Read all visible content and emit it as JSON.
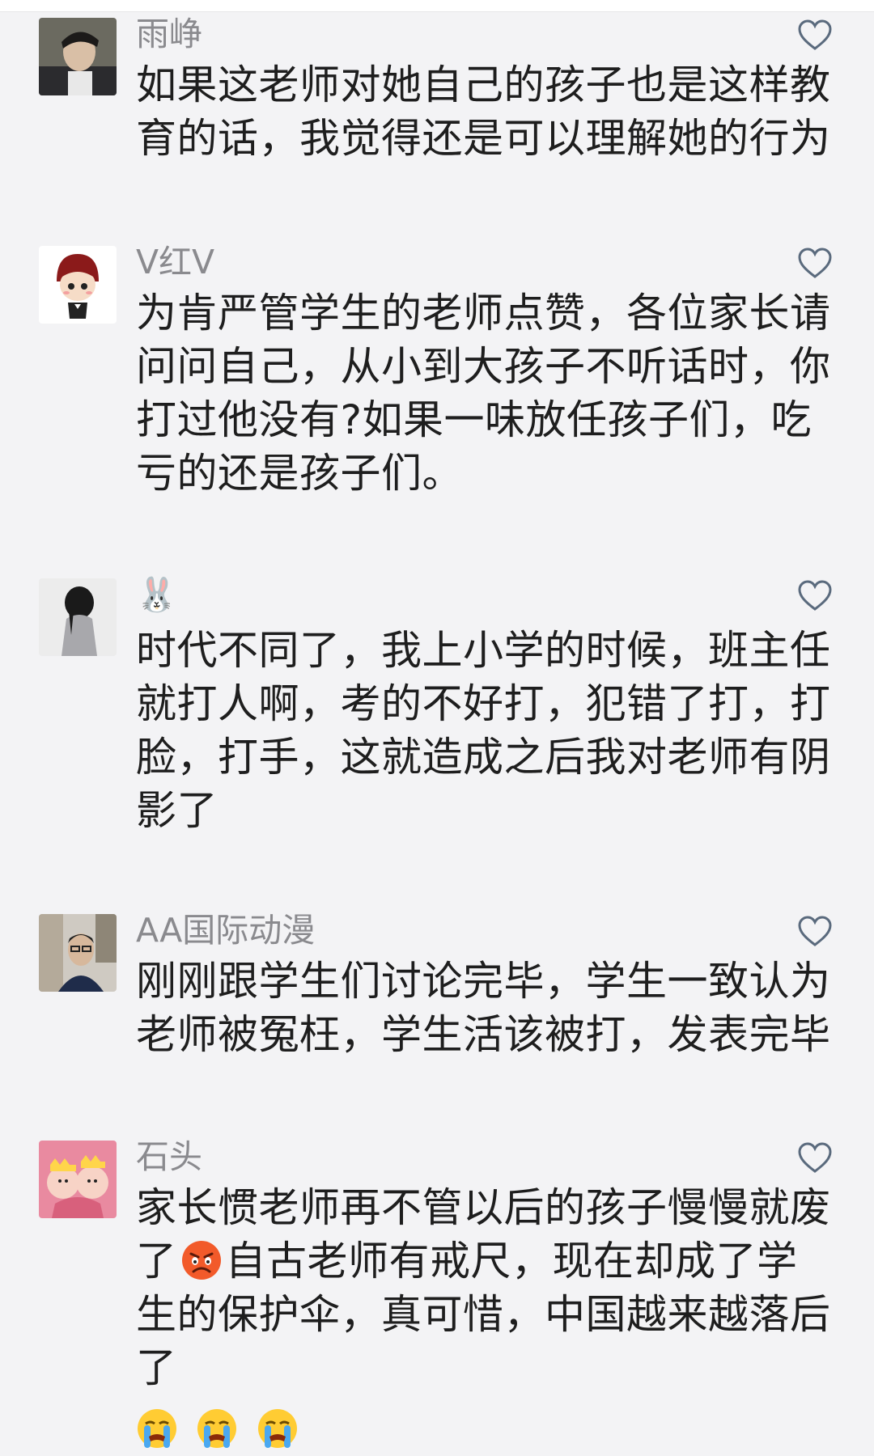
{
  "comments": [
    {
      "username": "雨峥",
      "text": "如果这老师对她自己的孩子也是这样教育的话，我觉得还是可以理解她的行为"
    },
    {
      "username": "V红V",
      "text": "为肯严管学生的老师点赞，各位家长请问问自己，从小到大孩子不听话时，你打过他没有?如果一味放任孩子们，吃亏的还是孩子们。"
    },
    {
      "username": "🐰",
      "text": "时代不同了，我上小学的时候，班主任就打人啊，考的不好打，犯错了打，打脸，打手，这就造成之后我对老师有阴影了"
    },
    {
      "username": "AA国际动漫",
      "text": "刚刚跟学生们讨论完毕，学生一致认为老师被冤枉，学生活该被打，发表完毕"
    },
    {
      "username": "石头",
      "text_before_emoji": "家长惯老师再不管以后的孩子慢慢就废了",
      "text_after_emoji": "自古老师有戒尺，现在却成了学生的保护伞，真可惜，中国越来越落后了",
      "inline_emoji": "angry-face-icon",
      "trailing_emojis": [
        "crying-face-icon",
        "crying-face-icon",
        "crying-face-icon"
      ]
    }
  ],
  "colors": {
    "background": "#f3f3f5",
    "username": "#8a8a8e",
    "text": "#1e1e1e",
    "heart": "#5a6a7d"
  }
}
